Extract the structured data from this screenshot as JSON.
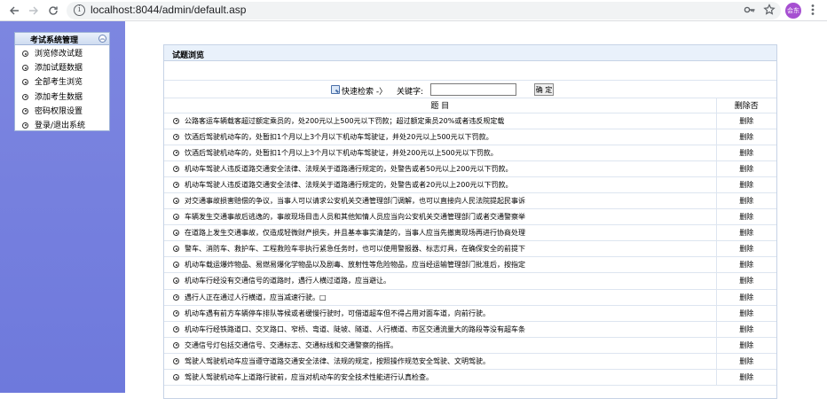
{
  "browser": {
    "url": "localhost:8044/admin/default.asp",
    "profile_label": "会东",
    "icons": [
      "back-arrow-icon",
      "forward-arrow-icon",
      "reload-icon",
      "info-icon",
      "key-icon",
      "star-icon",
      "kebab-menu-icon"
    ]
  },
  "sidebar": {
    "title": "考试系统管理",
    "items": [
      {
        "label": "浏览修改试题"
      },
      {
        "label": "添加试题数据"
      },
      {
        "label": "全部考生浏览"
      },
      {
        "label": "添加考生数据"
      },
      {
        "label": "密码权限设置"
      },
      {
        "label": "登录/退出系统"
      }
    ]
  },
  "main": {
    "panel_title": "试题浏览",
    "search": {
      "quick_search_label": "快速检索 -〉",
      "keyword_label": "关键字:",
      "keyword_value": "",
      "confirm_label": "确 定"
    },
    "table": {
      "headers": {
        "question": "题    目",
        "delete": "删除否"
      },
      "rows": [
        {
          "question": "公路客运车辆载客超过额定乘员的，处200元以上500元以下罚款；超过额定乘员20%或者违反规定载",
          "delete": "删除"
        },
        {
          "question": "饮酒后驾驶机动车的，处暂扣1个月以上3个月以下机动车驾驶证，并处20元以上500元以下罚款。",
          "delete": "删除"
        },
        {
          "question": "饮酒后驾驶机动车的，处暂扣1个月以上3个月以下机动车驾驶证，并处200元以上500元以下罚款。",
          "delete": "删除"
        },
        {
          "question": "机动车驾驶人违反道路交通安全法律、法规关于道路通行规定的，处警告或者50元以上200元以下罚款。",
          "delete": "删除"
        },
        {
          "question": "机动车驾驶人违反道路交通安全法律、法规关于道路通行规定的，处警告或者20元以上200元以下罚款。",
          "delete": "删除"
        },
        {
          "question": "对交通事故损害赔偿的争议，当事人可以请求公安机关交通管理部门调解，也可以直接向人民法院提起民事诉",
          "delete": "删除"
        },
        {
          "question": "车辆发生交通事故后逃逸的，事故现场目击人员和其他知情人员应当向公安机关交通管理部门或者交通警察举",
          "delete": "删除"
        },
        {
          "question": "在道路上发生交通事故，仅造成轻微财产损失，并且基本事实清楚的，当事人应当先撤离现场再进行协商处理",
          "delete": "删除"
        },
        {
          "question": "警车、消防车、救护车、工程救险车非执行紧急任务时，也可以使用警报器、标志灯具，在确保安全的前提下",
          "delete": "删除"
        },
        {
          "question": "机动车载运爆炸物品、易燃易爆化学物品以及剧毒、放射性等危险物品，应当经运输管理部门批准后，按指定",
          "delete": "删除"
        },
        {
          "question": "机动车行经没有交通信号的道路时，遇行人横过道路，应当避让。",
          "delete": "删除"
        },
        {
          "question": "遇行人正在通过人行横道，应当减速行驶。□",
          "delete": "删除"
        },
        {
          "question": "机动车遇有前方车辆停车排队等候或者缓慢行驶时，可借道超车但不得占用对面车道，向前行驶。",
          "delete": "删除"
        },
        {
          "question": "机动车行经铁路道口、交叉路口、窄桥、弯道、陡坡、隧道、人行横道、市区交通流量大的路段等没有超车条",
          "delete": "删除"
        },
        {
          "question": "交通信号灯包括交通信号、交通标志、交通标线和交通警察的指挥。",
          "delete": "删除"
        },
        {
          "question": "驾驶人驾驶机动车应当遵守道路交通安全法律、法规的规定，按照操作规范安全驾驶、文明驾驶。",
          "delete": "删除"
        },
        {
          "question": "驾驶人驾驶机动车上道路行驶前，应当对机动车的安全技术性能进行认真检查。",
          "delete": "删除"
        }
      ]
    }
  }
}
